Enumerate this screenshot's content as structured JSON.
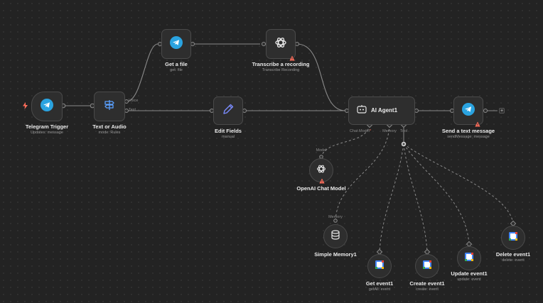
{
  "nodes": {
    "telegram_trigger": {
      "title": "Telegram Trigger",
      "subtitle": "Updates: message"
    },
    "text_or_audio": {
      "title": "Text or Audio",
      "subtitle": "mode: Rules",
      "out_voice": "Voice",
      "out_text": "Text"
    },
    "get_file": {
      "title": "Get a file",
      "subtitle": "get: file"
    },
    "transcribe": {
      "title": "Transcribe a recording",
      "subtitle": "Transcribe Recording"
    },
    "edit_fields": {
      "title": "Edit Fields",
      "subtitle": "manual"
    },
    "ai_agent": {
      "title": "AI Agent1",
      "port_chat_model": "Chat Model",
      "port_memory": "Memory",
      "port_tool": "Tool"
    },
    "send_message": {
      "title": "Send a text message",
      "subtitle": "sendMessage: message"
    },
    "openai_model": {
      "title": "OpenAI Chat Model",
      "port_label": "Model"
    },
    "simple_memory": {
      "title": "Simple Memory1",
      "port_label": "Memory"
    },
    "get_event": {
      "title": "Get event1",
      "subtitle": "getAll: event"
    },
    "create_event": {
      "title": "Create event1",
      "subtitle": "create: event"
    },
    "update_event": {
      "title": "Update event1",
      "subtitle": "update: event"
    },
    "delete_event": {
      "title": "Delete event1",
      "subtitle": "delete: event"
    }
  },
  "icons": {
    "trigger_bolt": "lightning-icon",
    "telegram": "telegram-icon",
    "switch": "switch-icon",
    "pencil": "pencil-icon",
    "openai": "openai-icon",
    "robot": "robot-icon",
    "database": "database-icon",
    "calendar": "google-calendar-icon",
    "warning": "warning-icon",
    "plus": "plus-icon"
  },
  "colors": {
    "canvas": "#232323",
    "telegram": "#2aa3e0",
    "warning": "#ff6d5a",
    "wire": "#8a8a8a"
  },
  "add_symbol": "+",
  "required_marker": "*"
}
